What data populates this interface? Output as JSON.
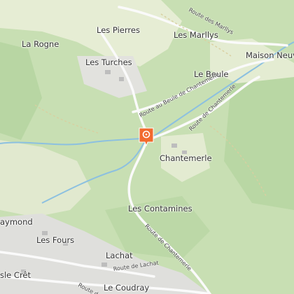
{
  "map": {
    "places": [
      {
        "id": "les-pierres",
        "label": "Les Pierres"
      },
      {
        "id": "la-rogne",
        "label": "La Rogne"
      },
      {
        "id": "les-turches",
        "label": "Les Turches"
      },
      {
        "id": "les-marllys",
        "label": "Les Marllys"
      },
      {
        "id": "maison-neuve",
        "label": "Maison Neuve"
      },
      {
        "id": "le-beule",
        "label": "Le Beule"
      },
      {
        "id": "chantemerle",
        "label": "Chantemerle"
      },
      {
        "id": "les-contamines",
        "label": "Les Contamines"
      },
      {
        "id": "raymond",
        "label": "aymond"
      },
      {
        "id": "les-fours",
        "label": "Les Fours"
      },
      {
        "id": "lachat",
        "label": "Lachat"
      },
      {
        "id": "le-cret",
        "label": "sle Crêt"
      },
      {
        "id": "le-coudray",
        "label": "Le Coudray"
      }
    ],
    "roads": [
      {
        "id": "route-des-marllys",
        "label": "Route des Marllys"
      },
      {
        "id": "route-au-beule",
        "label": "Route au Beule de Chantemerle"
      },
      {
        "id": "route-de-chantemerle-1",
        "label": "Route de Chantemerle"
      },
      {
        "id": "route-de-chantemerle-2",
        "label": "Route de Chantemerle"
      },
      {
        "id": "route-de-lachat",
        "label": "Route de Lachat"
      },
      {
        "id": "route-du-coudray",
        "label": "Route du"
      }
    ],
    "marker": {
      "icon": "map-pin-icon",
      "color": "#f26a2e"
    },
    "colors": {
      "forest": "#c3dcb0",
      "meadow": "#e4ecd2",
      "urban": "#dcdcdc",
      "stream": "#8cc0e0",
      "road": "#ffffff",
      "marker": "#f26a2e"
    }
  }
}
